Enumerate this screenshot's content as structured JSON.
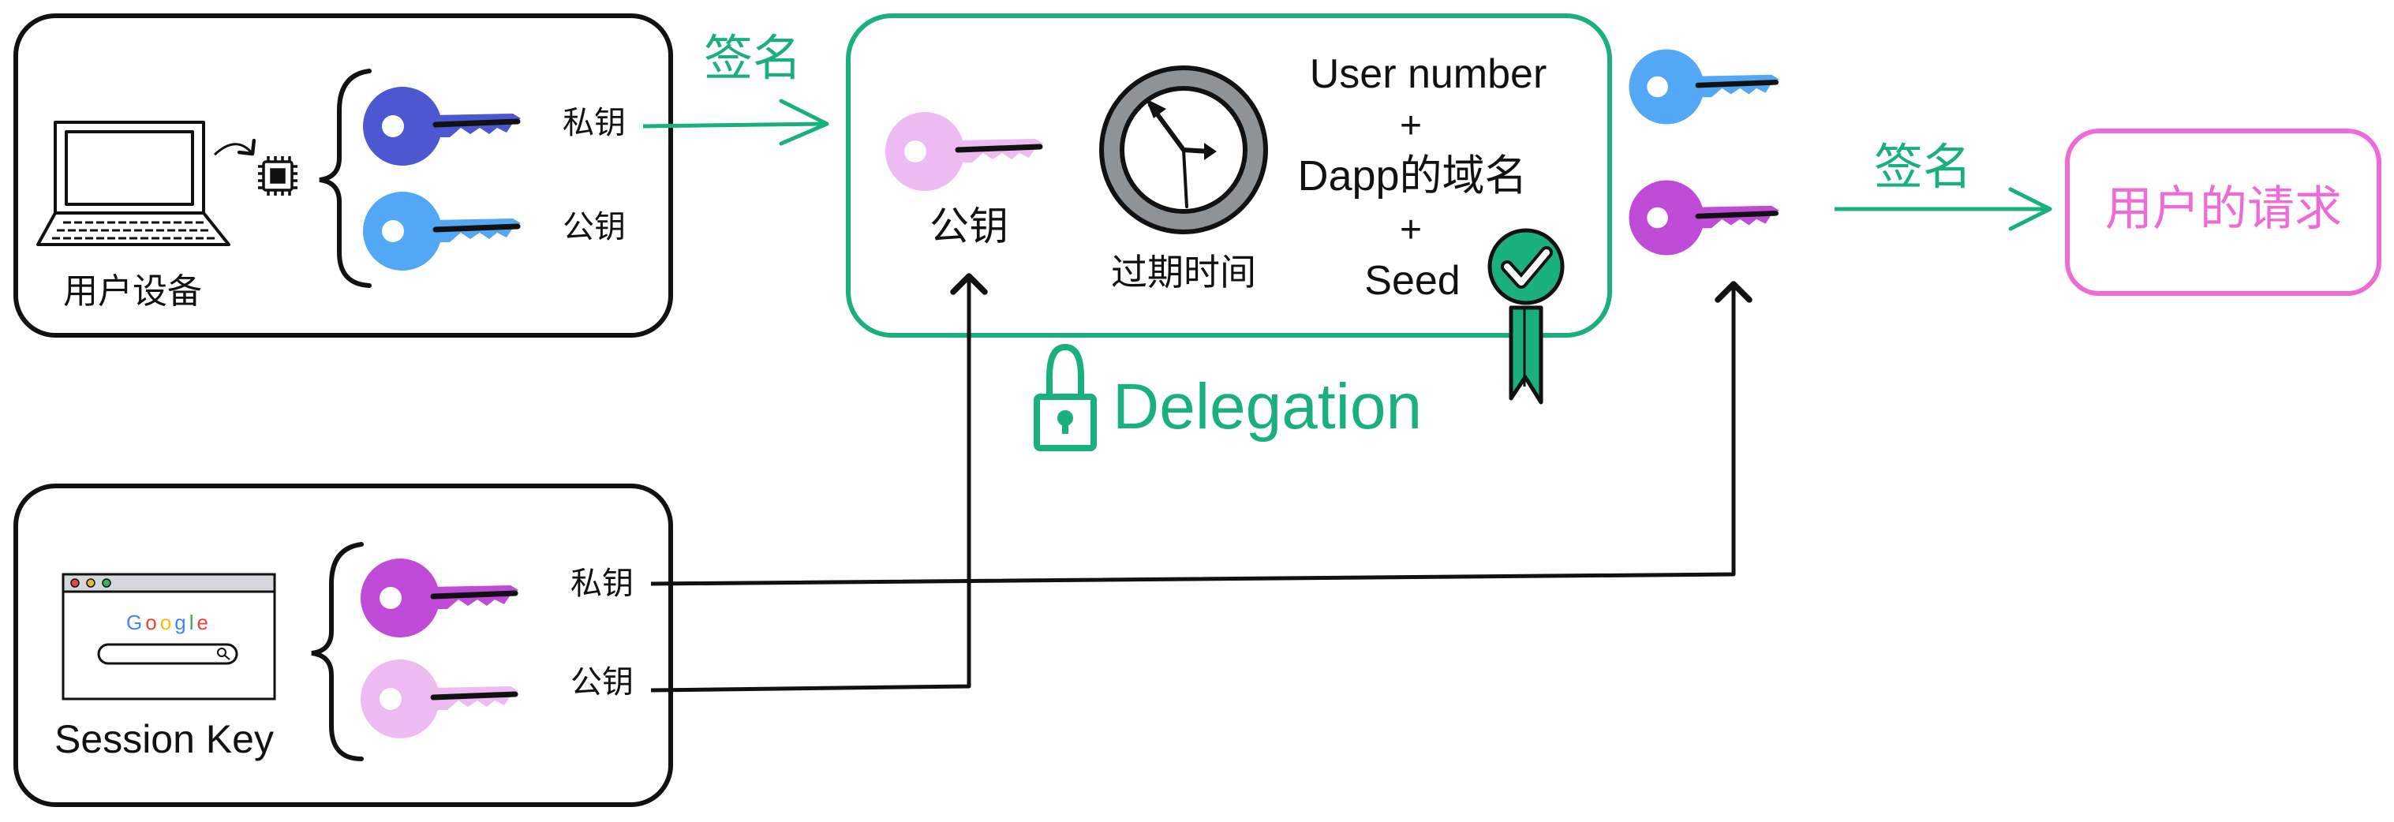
{
  "colors": {
    "green": "#1aaf7e",
    "pink": "#ef6ad8",
    "dark_blue_key": "#4c57d1",
    "light_blue_key": "#52a8f4",
    "purple_key": "#c04bd8",
    "light_pink_key": "#edbbf2",
    "outline": "#111111"
  },
  "user_device": {
    "label": "用户设备",
    "private_key_label": "私钥",
    "public_key_label": "公钥",
    "icons": [
      "laptop-icon",
      "chip-icon",
      "dark-blue-key-icon",
      "light-blue-key-icon"
    ]
  },
  "session": {
    "label": "Session Key",
    "google_text": "Google",
    "private_key_label": "私钥",
    "public_key_label": "公钥",
    "icons": [
      "browser-window-icon",
      "purple-key-icon",
      "light-pink-key-icon"
    ]
  },
  "delegation": {
    "sign_label": "签名",
    "public_key_label": "公钥",
    "expiry_label": "过期时间",
    "content_lines": [
      "User number",
      "+",
      "Dapp的域名",
      "+",
      "Seed"
    ],
    "title": "Delegation",
    "icons": [
      "clock-icon",
      "award-badge-icon",
      "lock-icon"
    ]
  },
  "request": {
    "sign_label": "签名",
    "label": "用户的请求"
  }
}
